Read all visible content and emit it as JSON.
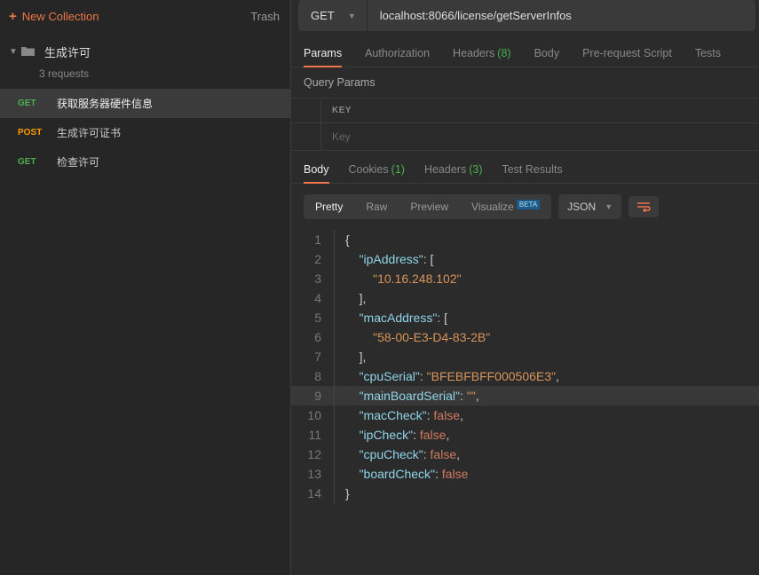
{
  "sidebar": {
    "new_collection": "New Collection",
    "trash": "Trash",
    "collection_name": "生成许可",
    "collection_sub": "3 requests",
    "requests": [
      {
        "method": "GET",
        "label": "获取服务器硬件信息"
      },
      {
        "method": "POST",
        "label": "生成许可证书"
      },
      {
        "method": "GET",
        "label": "检查许可"
      }
    ]
  },
  "request": {
    "method": "GET",
    "url": "localhost:8066/license/getServerInfos"
  },
  "tabs": {
    "params": "Params",
    "authorization": "Authorization",
    "headers": "Headers",
    "headers_count": "(8)",
    "body": "Body",
    "pre": "Pre-request Script",
    "tests": "Tests"
  },
  "query": {
    "title": "Query Params",
    "key_header": "KEY",
    "key_placeholder": "Key"
  },
  "resp_tabs": {
    "body": "Body",
    "cookies": "Cookies",
    "cookies_count": "(1)",
    "headers": "Headers",
    "headers_count": "(3)",
    "test_results": "Test Results"
  },
  "view": {
    "pretty": "Pretty",
    "raw": "Raw",
    "preview": "Preview",
    "visualize": "Visualize",
    "beta": "BETA",
    "format": "JSON"
  },
  "response_json": {
    "ipAddress": [
      "10.16.248.102"
    ],
    "macAddress": [
      "58-00-E3-D4-83-2B"
    ],
    "cpuSerial": "BFEBFBFF000506E3",
    "mainBoardSerial": "",
    "macCheck": false,
    "ipCheck": false,
    "cpuCheck": false,
    "boardCheck": false
  },
  "code_lines": [
    {
      "n": 1,
      "html": "<span class='punc'>{</span>"
    },
    {
      "n": 2,
      "html": "    <span class='key'>\"ipAddress\"</span><span class='punc'>: [</span>"
    },
    {
      "n": 3,
      "html": "        <span class='str'>\"10.16.248.102\"</span>"
    },
    {
      "n": 4,
      "html": "    <span class='punc'>],</span>"
    },
    {
      "n": 5,
      "html": "    <span class='key'>\"macAddress\"</span><span class='punc'>: [</span>"
    },
    {
      "n": 6,
      "html": "        <span class='str'>\"58-00-E3-D4-83-2B\"</span>"
    },
    {
      "n": 7,
      "html": "    <span class='punc'>],</span>"
    },
    {
      "n": 8,
      "html": "    <span class='key'>\"cpuSerial\"</span><span class='punc'>: </span><span class='str'>\"BFEBFBFF000506E3\"</span><span class='punc'>,</span>"
    },
    {
      "n": 9,
      "hl": true,
      "html": "    <span class='key'>\"mainBoardSerial\"</span><span class='punc'>: </span><span class='str'>\"\"</span><span class='punc'>,</span>"
    },
    {
      "n": 10,
      "html": "    <span class='key'>\"macCheck\"</span><span class='punc'>: </span><span class='bool'>false</span><span class='punc'>,</span>"
    },
    {
      "n": 11,
      "html": "    <span class='key'>\"ipCheck\"</span><span class='punc'>: </span><span class='bool'>false</span><span class='punc'>,</span>"
    },
    {
      "n": 12,
      "html": "    <span class='key'>\"cpuCheck\"</span><span class='punc'>: </span><span class='bool'>false</span><span class='punc'>,</span>"
    },
    {
      "n": 13,
      "html": "    <span class='key'>\"boardCheck\"</span><span class='punc'>: </span><span class='bool'>false</span>"
    },
    {
      "n": 14,
      "html": "<span class='punc'>}</span>"
    }
  ]
}
